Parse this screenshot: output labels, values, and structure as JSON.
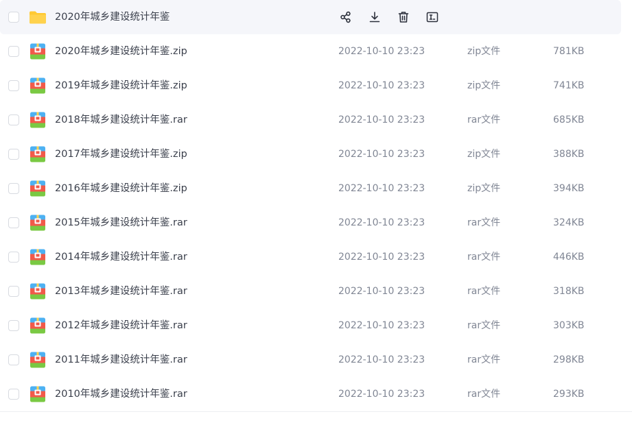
{
  "folder": {
    "name": "2020年城乡建设统计年鉴",
    "icon": "folder-icon",
    "actions": [
      {
        "icon": "share-icon",
        "name": "share-button"
      },
      {
        "icon": "download-icon",
        "name": "download-button"
      },
      {
        "icon": "delete-icon",
        "name": "delete-button"
      },
      {
        "icon": "rename-icon",
        "name": "rename-button"
      }
    ]
  },
  "files": [
    {
      "name": "2020年城乡建设统计年鉴.zip",
      "date": "2022-10-10 23:23",
      "type": "zip文件",
      "size": "781KB"
    },
    {
      "name": "2019年城乡建设统计年鉴.zip",
      "date": "2022-10-10 23:23",
      "type": "zip文件",
      "size": "741KB"
    },
    {
      "name": "2018年城乡建设统计年鉴.rar",
      "date": "2022-10-10 23:23",
      "type": "rar文件",
      "size": "685KB"
    },
    {
      "name": "2017年城乡建设统计年鉴.zip",
      "date": "2022-10-10 23:23",
      "type": "zip文件",
      "size": "388KB"
    },
    {
      "name": "2016年城乡建设统计年鉴.zip",
      "date": "2022-10-10 23:23",
      "type": "zip文件",
      "size": "394KB"
    },
    {
      "name": "2015年城乡建设统计年鉴.rar",
      "date": "2022-10-10 23:23",
      "type": "rar文件",
      "size": "324KB"
    },
    {
      "name": "2014年城乡建设统计年鉴.rar",
      "date": "2022-10-10 23:23",
      "type": "rar文件",
      "size": "446KB"
    },
    {
      "name": "2013年城乡建设统计年鉴.rar",
      "date": "2022-10-10 23:23",
      "type": "rar文件",
      "size": "318KB"
    },
    {
      "name": "2012年城乡建设统计年鉴.rar",
      "date": "2022-10-10 23:23",
      "type": "rar文件",
      "size": "303KB"
    },
    {
      "name": "2011年城乡建设统计年鉴.rar",
      "date": "2022-10-10 23:23",
      "type": "rar文件",
      "size": "298KB"
    },
    {
      "name": "2010年城乡建设统计年鉴.rar",
      "date": "2022-10-10 23:23",
      "type": "rar文件",
      "size": "293KB"
    }
  ],
  "file_icon": "archive-icon",
  "colors": {
    "folder": "#ffc933",
    "archive_top": "#4db1f2",
    "archive_mid": "#f15a4a",
    "archive_bottom": "#7ac943",
    "hover_row": "#f5f6fa"
  }
}
